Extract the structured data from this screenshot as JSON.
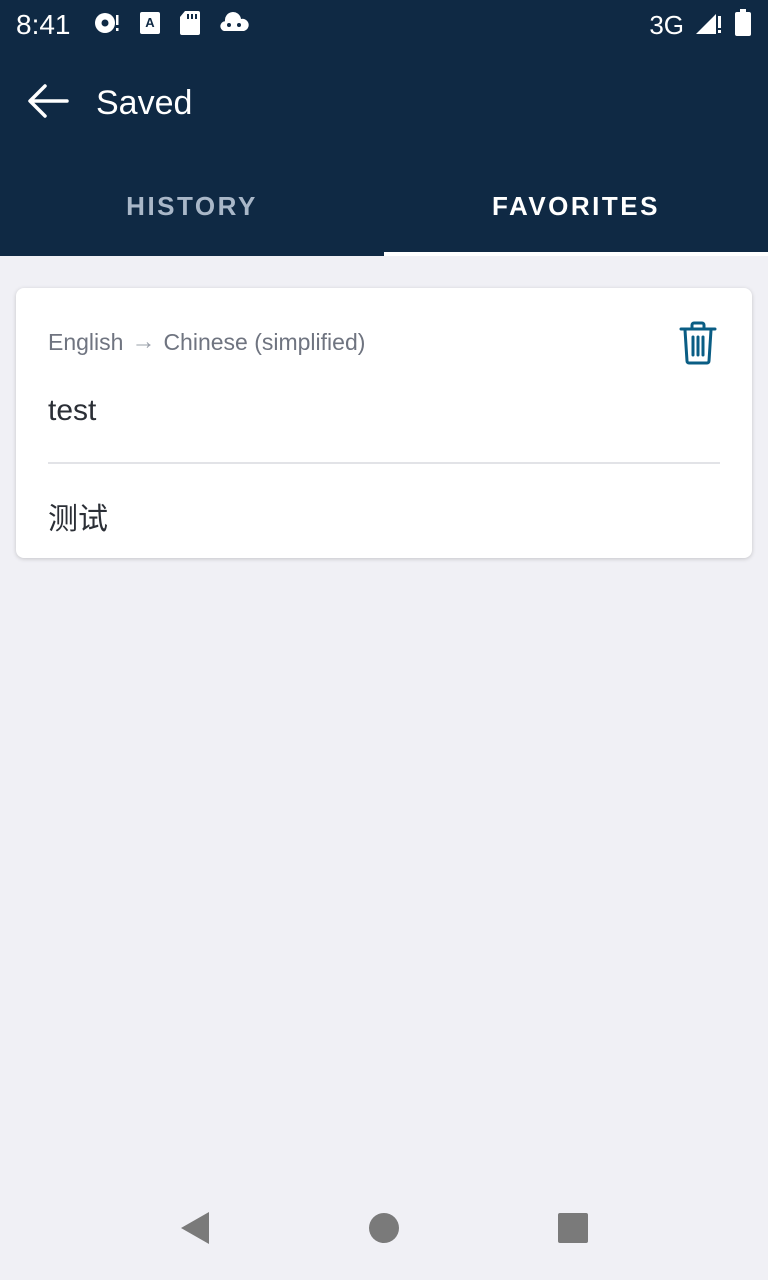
{
  "status_bar": {
    "time": "8:41",
    "network": "3G",
    "icons_left": [
      "sync-icon",
      "font-icon",
      "sd-card-icon",
      "cloud-icon"
    ],
    "icons_right": [
      "signal-icon",
      "battery-icon"
    ]
  },
  "app_bar": {
    "title": "Saved",
    "back_icon": "arrow-left-icon"
  },
  "tabs": [
    {
      "label": "HISTORY",
      "active": false
    },
    {
      "label": "FAVORITES",
      "active": true
    }
  ],
  "favorites": [
    {
      "source_language": "English",
      "arrow": "→",
      "target_language": "Chinese (simplified)",
      "source_text": "test",
      "translated_text": "测试",
      "delete_icon": "trash-icon"
    }
  ],
  "colors": {
    "primary": "#0f2944",
    "accent": "#0a5d84",
    "background": "#f0f0f5"
  },
  "nav_bar": {
    "icons": [
      "back-triangle-icon",
      "home-circle-icon",
      "recents-square-icon"
    ]
  }
}
